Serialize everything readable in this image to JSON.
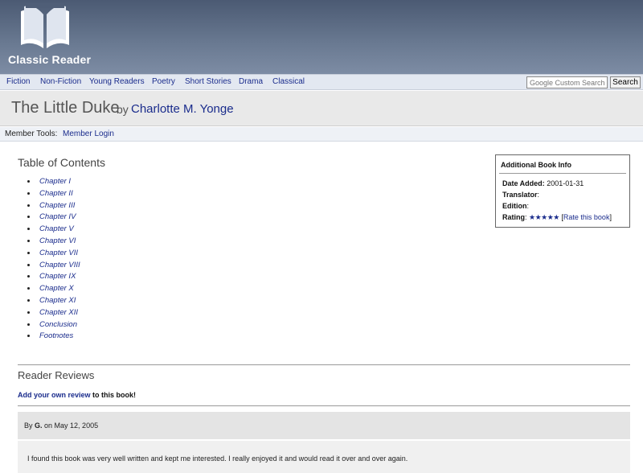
{
  "site": {
    "name": "Classic Reader"
  },
  "nav": {
    "items": [
      "Fiction",
      "Non-Fiction",
      "Young Readers",
      "Poetry",
      "Short Stories",
      "Drama",
      "Classical"
    ],
    "search_placeholder": "Google Custom Search",
    "search_button": "Search"
  },
  "book": {
    "title": "The Little Duke",
    "by": "by",
    "author": "Charlotte M. Yonge"
  },
  "tools": {
    "label": "Member Tools:",
    "login": "Member Login"
  },
  "toc": {
    "heading": "Table of Contents",
    "items": [
      "Chapter I",
      "Chapter II",
      "Chapter III",
      "Chapter IV",
      "Chapter V",
      "Chapter VI",
      "Chapter VII",
      "Chapter VIII",
      "Chapter IX",
      "Chapter X",
      "Chapter XI",
      "Chapter XII",
      "Conclusion",
      "Footnotes"
    ]
  },
  "info": {
    "title": "Additional Book Info",
    "date_label": "Date Added:",
    "date_value": "2001-01-31",
    "translator_label": "Translator",
    "translator_colon": ":",
    "edition_label": "Edition",
    "edition_colon": ":",
    "rating_label": "Rating",
    "rating_colon": ":",
    "rating_stars": "★★★★★",
    "rate_open": "[",
    "rate_link": "Rate this book",
    "rate_close": "]"
  },
  "reviews": {
    "heading": "Reader Reviews",
    "add_link": "Add your own review",
    "add_suffix": " to this book!",
    "items": [
      {
        "by_prefix": "By ",
        "author": "G.",
        "date_prefix": " on ",
        "date": "May 12, 2005",
        "text": "I found this book was very well written and kept me interested. I really enjoyed it and would read it over and over again."
      }
    ]
  }
}
